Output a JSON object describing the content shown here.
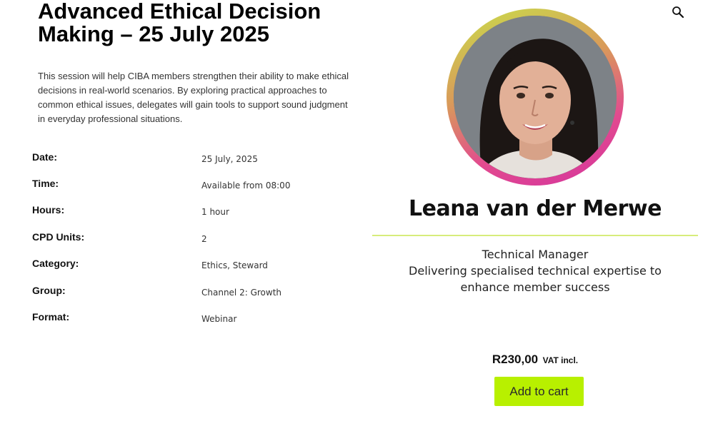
{
  "event": {
    "title": "Advanced Ethical Decision Making – 25 July 2025",
    "description": "This session will help CIBA members strengthen their ability to make ethical decisions in real-world scenarios. By exploring practical approaches to common ethical issues, delegates will gain tools to support sound judgment in everyday professional situations."
  },
  "details": [
    {
      "label": "Date:",
      "value": "25 July, 2025"
    },
    {
      "label": "Time:",
      "value": "Available from 08:00"
    },
    {
      "label": "Hours:",
      "value": "1 hour"
    },
    {
      "label": "CPD Units:",
      "value": "2"
    },
    {
      "label": "Category:",
      "value": "Ethics, Steward"
    },
    {
      "label": "Group:",
      "value": "Channel 2: Growth"
    },
    {
      "label": "Format:",
      "value": "Webinar"
    }
  ],
  "speaker": {
    "name": "Leana van der Merwe",
    "role": "Technical Manager",
    "tagline": "Delivering specialised technical expertise to enhance member success"
  },
  "purchase": {
    "price": "R230,00",
    "vat_note": "VAT incl.",
    "cart_label": "Add to cart"
  },
  "icons": {
    "search": "search-icon"
  },
  "colors": {
    "accent": "#b8f000",
    "divider": "#d7ec7b",
    "ring_top": "#c8e04a",
    "ring_bottom": "#d4349e"
  }
}
